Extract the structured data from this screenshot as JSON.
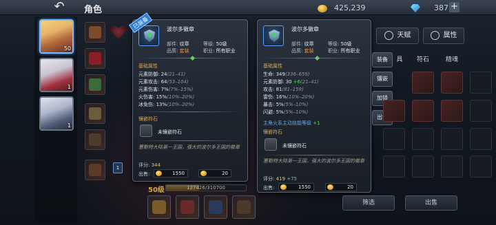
{
  "header": {
    "back_icon": "back-arrow-icon",
    "title": "角色",
    "gold": "425,239",
    "diamonds": "387",
    "plus": "+"
  },
  "characters": [
    {
      "level": "50",
      "selected": true
    },
    {
      "level": "1",
      "selected": false
    },
    {
      "level": "1",
      "selected": false
    }
  ],
  "left_panel": {
    "level": "50级",
    "xp": "127426/310700",
    "xp_fraction": 0.41,
    "badge": "1"
  },
  "equipped_ribbon": "已装备",
  "cards": [
    {
      "name": "波尔多徽章",
      "part_label": "部件:",
      "part": "纹章",
      "level_label": "等级:",
      "level": "50级",
      "quality_label": "品质:",
      "quality": "套装",
      "job_label": "职业:",
      "job": "所有职业",
      "base_title": "基础属性",
      "stats": [
        {
          "text": "元素防御: 24",
          "range": "(21–41)"
        },
        {
          "text": "元素攻击: 64",
          "range": "(53–104)"
        },
        {
          "text": "元素伤害: 7%",
          "range": "(7%–15%)"
        },
        {
          "text": "火伤害: 15%",
          "range": "(10%–20%)"
        },
        {
          "text": "冰免伤: 13%",
          "range": "(10%–20%)"
        }
      ],
      "socket_title": "镶嵌符石",
      "socket_text": "未镶嵌符石",
      "flavor": "塞勒特大陆第一王国，强大的波尔多王国的徽章",
      "score_label": "评分:",
      "score": "344",
      "sell_label": "出售:",
      "price": "1550",
      "qty": "20"
    },
    {
      "name": "波尔多徽章",
      "part_label": "部件:",
      "part": "纹章",
      "level_label": "等级:",
      "level": "50级",
      "quality_label": "品质:",
      "quality": "套装",
      "job_label": "职业:",
      "job": "所有职业",
      "base_title": "基础属性",
      "stats": [
        {
          "text": "生命: 349",
          "range": "(336–659)"
        },
        {
          "text": "元素防御: 30 ",
          "bonus": "+6",
          "range": "(21–41)"
        },
        {
          "text": "攻击: 81",
          "range": "(81–159)"
        },
        {
          "text": "雷伤: 16%",
          "range": "(10%–20%)"
        },
        {
          "text": "暴击: 5%",
          "range": "(5%–10%)"
        },
        {
          "text": "闪避: 5%",
          "range": "(5%–10%)"
        }
      ],
      "bonus_line": "主角火系主动技能等级 ",
      "bonus_value": "+1",
      "socket_title": "镶嵌符石",
      "socket_text": "未镶嵌符石",
      "flavor": "塞勒特大陆第一王国，强大的波尔多王国的徽章",
      "score_label": "评分:",
      "score": "419",
      "score_bonus": "+75",
      "sell_label": "出售:",
      "price": "1550",
      "qty": "20"
    }
  ],
  "right_panel": {
    "talent": "天赋",
    "attributes": "属性",
    "subtabs": [
      "具",
      "符石",
      "精魂"
    ],
    "actions": [
      "装备",
      "镶嵌",
      "加锁",
      "出售"
    ],
    "filter": "筛选",
    "sell": "出售"
  },
  "colors": {
    "accent_blue": "#2e7fd9",
    "set_orange": "#ef8f35",
    "green_bonus": "#5bd36a",
    "gold": "#d2a84f"
  }
}
